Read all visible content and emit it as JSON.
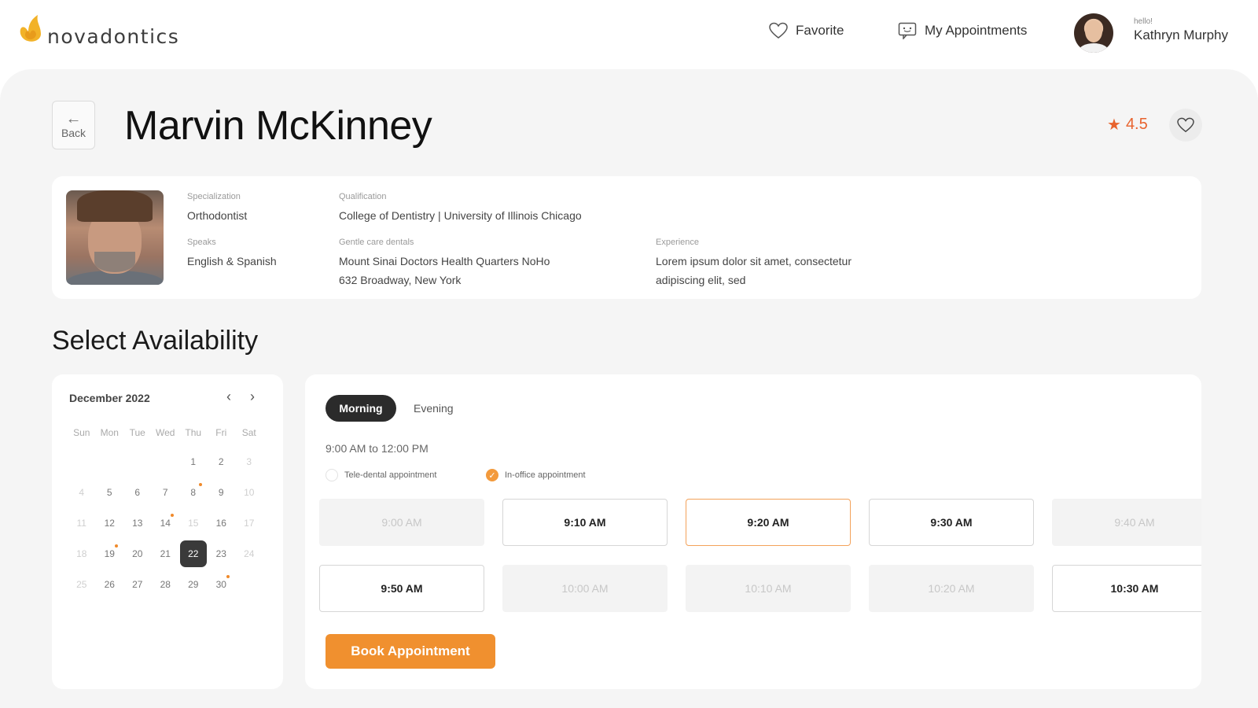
{
  "brand": {
    "name": "novadontics",
    "accent": "#f0902f"
  },
  "nav": {
    "favorite_label": "Favorite",
    "appointments_label": "My Appointments",
    "user_hello": "hello!",
    "user_name": "Kathryn Murphy"
  },
  "doctor": {
    "back_label": "Back",
    "name": "Marvin McKinney",
    "rating": "4.5",
    "specialization_label": "Specialization",
    "specialization": "Orthodontist",
    "qualification_label": "Qualification",
    "qualification": "College of Dentistry | University of Illinois Chicago",
    "speaks_label": "Speaks",
    "speaks": "English & Spanish",
    "centre_label": "Gentle care dentals",
    "centre_line1": "Mount Sinai Doctors Health Quarters NoHo",
    "centre_line2": "632 Broadway, New York",
    "experience_label": "Experience",
    "experience_line1": "Lorem ipsum dolor sit amet, consectetur",
    "experience_line2": "adipiscing elit, sed"
  },
  "availability": {
    "title": "Select Availability",
    "calendar": {
      "month": "December 2022",
      "weekdays": [
        "Sun",
        "Mon",
        "Tue",
        "Wed",
        "Thu",
        "Fri",
        "Sat"
      ],
      "weeks": [
        [
          "",
          "",
          "",
          "",
          "1",
          "2",
          "3"
        ],
        [
          "4",
          "5",
          "6",
          "7",
          "8",
          "9",
          "10"
        ],
        [
          "11",
          "12",
          "13",
          "14",
          "15",
          "16",
          "17"
        ],
        [
          "18",
          "19",
          "20",
          "21",
          "22",
          "23",
          "24"
        ],
        [
          "25",
          "26",
          "27",
          "28",
          "29",
          "30",
          ""
        ]
      ],
      "selected_day": "22",
      "highlighted_days": [
        "8",
        "14",
        "19",
        "30"
      ],
      "muted_days": [
        "3",
        "4",
        "10",
        "11",
        "15",
        "17",
        "18",
        "24",
        "25"
      ]
    },
    "tabs": {
      "morning": "Morning",
      "evening": "Evening",
      "active": "Morning"
    },
    "time_range": "9:00 AM to 12:00 PM",
    "appointment_types": {
      "tele": "Tele-dental appointment",
      "office": "In-office appointment",
      "selected": "office"
    },
    "slots": [
      {
        "time": "9:00 AM",
        "state": "disabled"
      },
      {
        "time": "9:10 AM",
        "state": "available"
      },
      {
        "time": "9:20 AM",
        "state": "selected"
      },
      {
        "time": "9:30 AM",
        "state": "available"
      },
      {
        "time": "9:40 AM",
        "state": "disabled"
      },
      {
        "time": "9:50 AM",
        "state": "available"
      },
      {
        "time": "10:00 AM",
        "state": "disabled"
      },
      {
        "time": "10:10 AM",
        "state": "disabled"
      },
      {
        "time": "10:20 AM",
        "state": "disabled"
      },
      {
        "time": "10:30 AM",
        "state": "available"
      }
    ],
    "book_label": "Book Appointment"
  }
}
